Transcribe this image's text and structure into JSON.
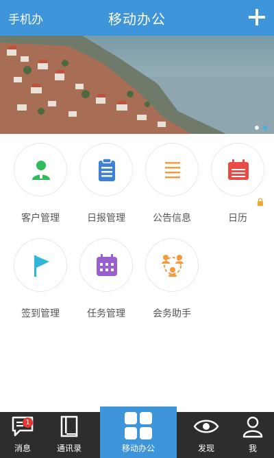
{
  "header": {
    "left_label": "手机办",
    "title": "移动办公"
  },
  "banner": {
    "dot_count": 2,
    "active_dot": 1
  },
  "apps": [
    {
      "label": "客户管理",
      "icon": "person-icon",
      "color": "#2ebd5a"
    },
    {
      "label": "日报管理",
      "icon": "clipboard-icon",
      "color": "#3f7fd4"
    },
    {
      "label": "公告信息",
      "icon": "list-icon",
      "color": "#f39a3b"
    },
    {
      "label": "日历",
      "icon": "calendar-icon",
      "color": "#e94b47",
      "locked": true
    },
    {
      "label": "签到管理",
      "icon": "flag-icon",
      "color": "#30b7d8"
    },
    {
      "label": "任务管理",
      "icon": "task-calendar-icon",
      "color": "#9a5fcf"
    },
    {
      "label": "会务助手",
      "icon": "meeting-icon",
      "color": "#f39a3b"
    }
  ],
  "tabbar": {
    "items": [
      {
        "label": "消息",
        "icon": "chat-icon",
        "badge": "1"
      },
      {
        "label": "通讯录",
        "icon": "contacts-book-icon"
      },
      {
        "label": "移动办公",
        "icon": "grid-icon",
        "active": true
      },
      {
        "label": "发现",
        "icon": "eye-icon"
      },
      {
        "label": "我",
        "icon": "user-icon"
      }
    ]
  },
  "colors": {
    "primary": "#3f95da",
    "tabbar_bg": "#2d2d2d",
    "badge": "#e53935"
  }
}
